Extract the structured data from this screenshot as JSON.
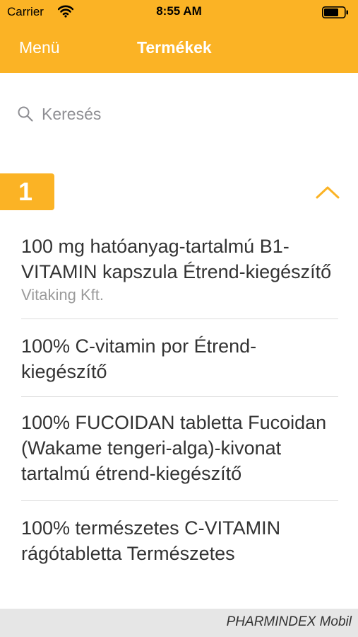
{
  "status_bar": {
    "carrier": "Carrier",
    "time": "8:55 AM"
  },
  "nav": {
    "menu_label": "Menü",
    "title": "Termékek"
  },
  "search": {
    "placeholder": "Keresés"
  },
  "section": {
    "label": "1"
  },
  "items": [
    {
      "name": "100 mg hatóanyag-tartalmú B1-VITAMIN kapszula Étrend-kiegészítő",
      "maker": "Vitaking Kft."
    },
    {
      "name": "100% C-vitamin por Étrend-kiegészítő"
    },
    {
      "name": "100% FUCOIDAN tabletta Fucoidan (Wakame tengeri-alga)-kivonat tartalmú étrend-kiegészítő"
    },
    {
      "name": "100% természetes C-VITAMIN rágótabletta Természetes"
    }
  ],
  "footer": {
    "brand": "PHARMINDEX Mobil"
  },
  "colors": {
    "accent": "#FBB325"
  }
}
